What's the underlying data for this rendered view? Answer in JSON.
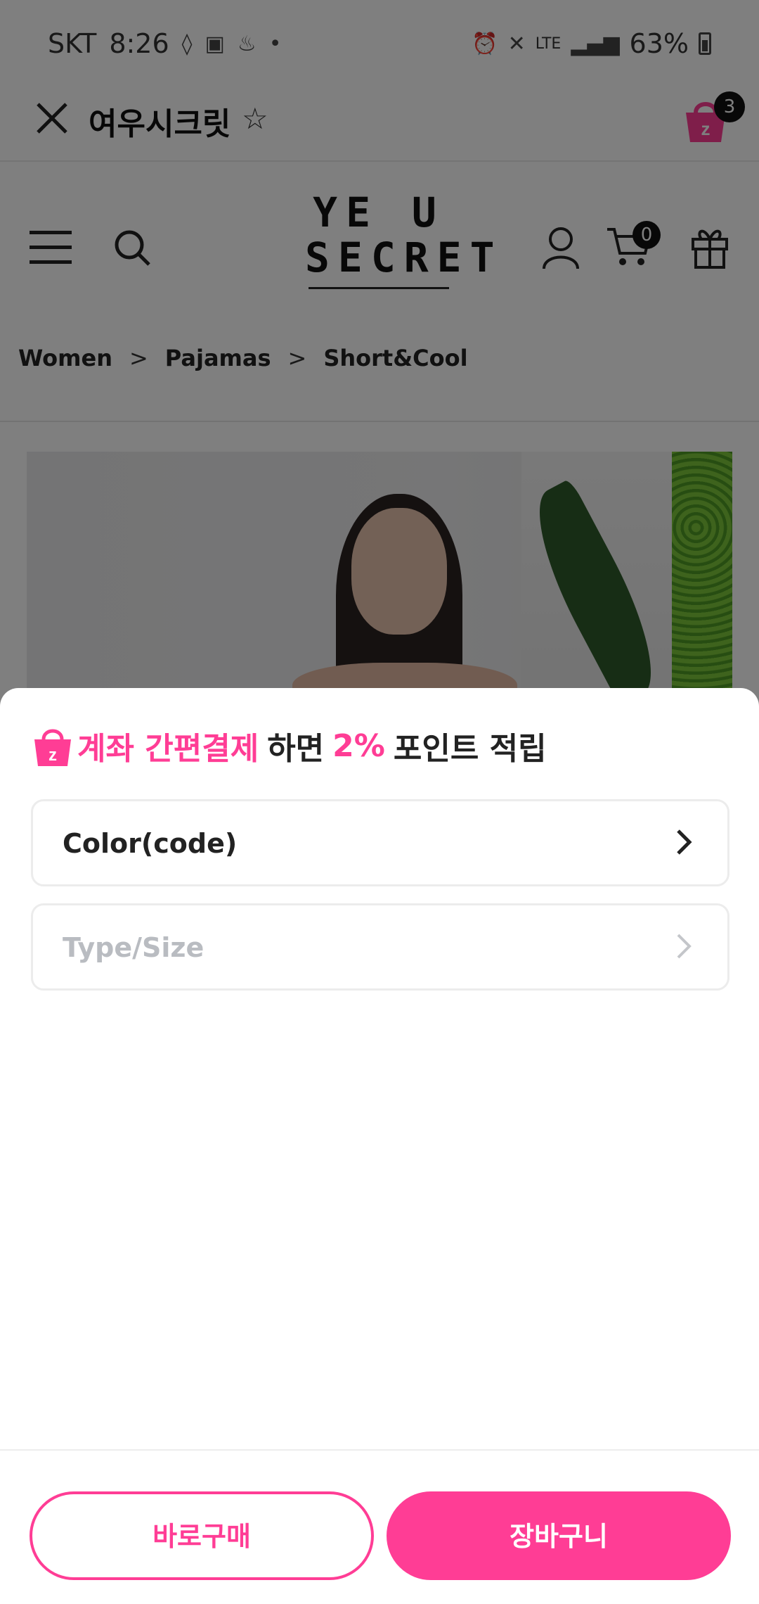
{
  "status_bar": {
    "carrier": "SKT",
    "time": "8:26",
    "network": "LTE",
    "battery": "63%"
  },
  "app_header": {
    "title": "여우시크릿",
    "cart_badge_count": "3"
  },
  "site": {
    "logo_line1": "YE  U",
    "logo_line2": "SECRET",
    "cart_count": "0"
  },
  "breadcrumb": [
    "Women",
    "Pajamas",
    "Short&Cool"
  ],
  "breadcrumb_separator": ">",
  "sheet": {
    "promo": {
      "highlight": "계좌 간편결제",
      "text1": "하면",
      "percent": "2%",
      "text2": "포인트 적립"
    },
    "options": [
      {
        "label": "Color(code)",
        "enabled": true
      },
      {
        "label": "Type/Size",
        "enabled": false
      }
    ],
    "buttons": {
      "buy_now": "바로구매",
      "add_to_cart": "장바구니"
    }
  },
  "colors": {
    "accent": "#ff3d95",
    "disabled_text": "#b9bcc1"
  }
}
